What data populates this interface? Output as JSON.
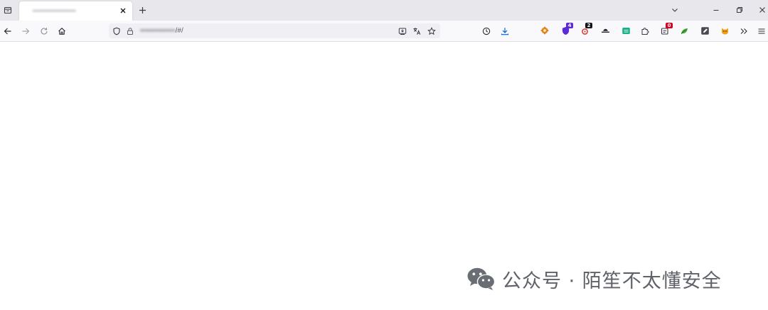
{
  "browser": {
    "tab": {
      "title": "▪▪▪▪▪▪▪▪▪▪▪▪▪▪▪▪▪▪▪"
    },
    "address": {
      "host_blurred": "▪▪▪▪▪▪▪▪▪▪▪▪▪▪",
      "path": "/#/"
    },
    "extensions": [
      {
        "name": "ext-orange-gear-icon",
        "color": "#e8871e"
      },
      {
        "name": "ext-purple-shield-icon",
        "color": "#5b2bd6",
        "badge": "4",
        "badge_color": "#5b2bd6"
      },
      {
        "name": "ext-red-bug-icon",
        "color": "#d83a3a",
        "badge": "2",
        "badge_color": "#15141a"
      },
      {
        "name": "ext-hat-icon",
        "color": "#2b2a33"
      },
      {
        "name": "ext-green-box-icon",
        "color": "#1bb188"
      },
      {
        "name": "ext-puzzle-icon",
        "color": "#5b5b66"
      },
      {
        "name": "ext-cookie-icon",
        "color": "#5b5b66",
        "badge": "0",
        "badge_color": "#d70022"
      },
      {
        "name": "ext-green-leaf-icon",
        "color": "#46a83a"
      },
      {
        "name": "ext-edit-box-icon",
        "color": "#4a4a55"
      },
      {
        "name": "ext-orange-fox-icon",
        "color": "#f0a11a"
      }
    ]
  },
  "watermark": {
    "text": "公众号 · 陌笙不太懂安全"
  }
}
